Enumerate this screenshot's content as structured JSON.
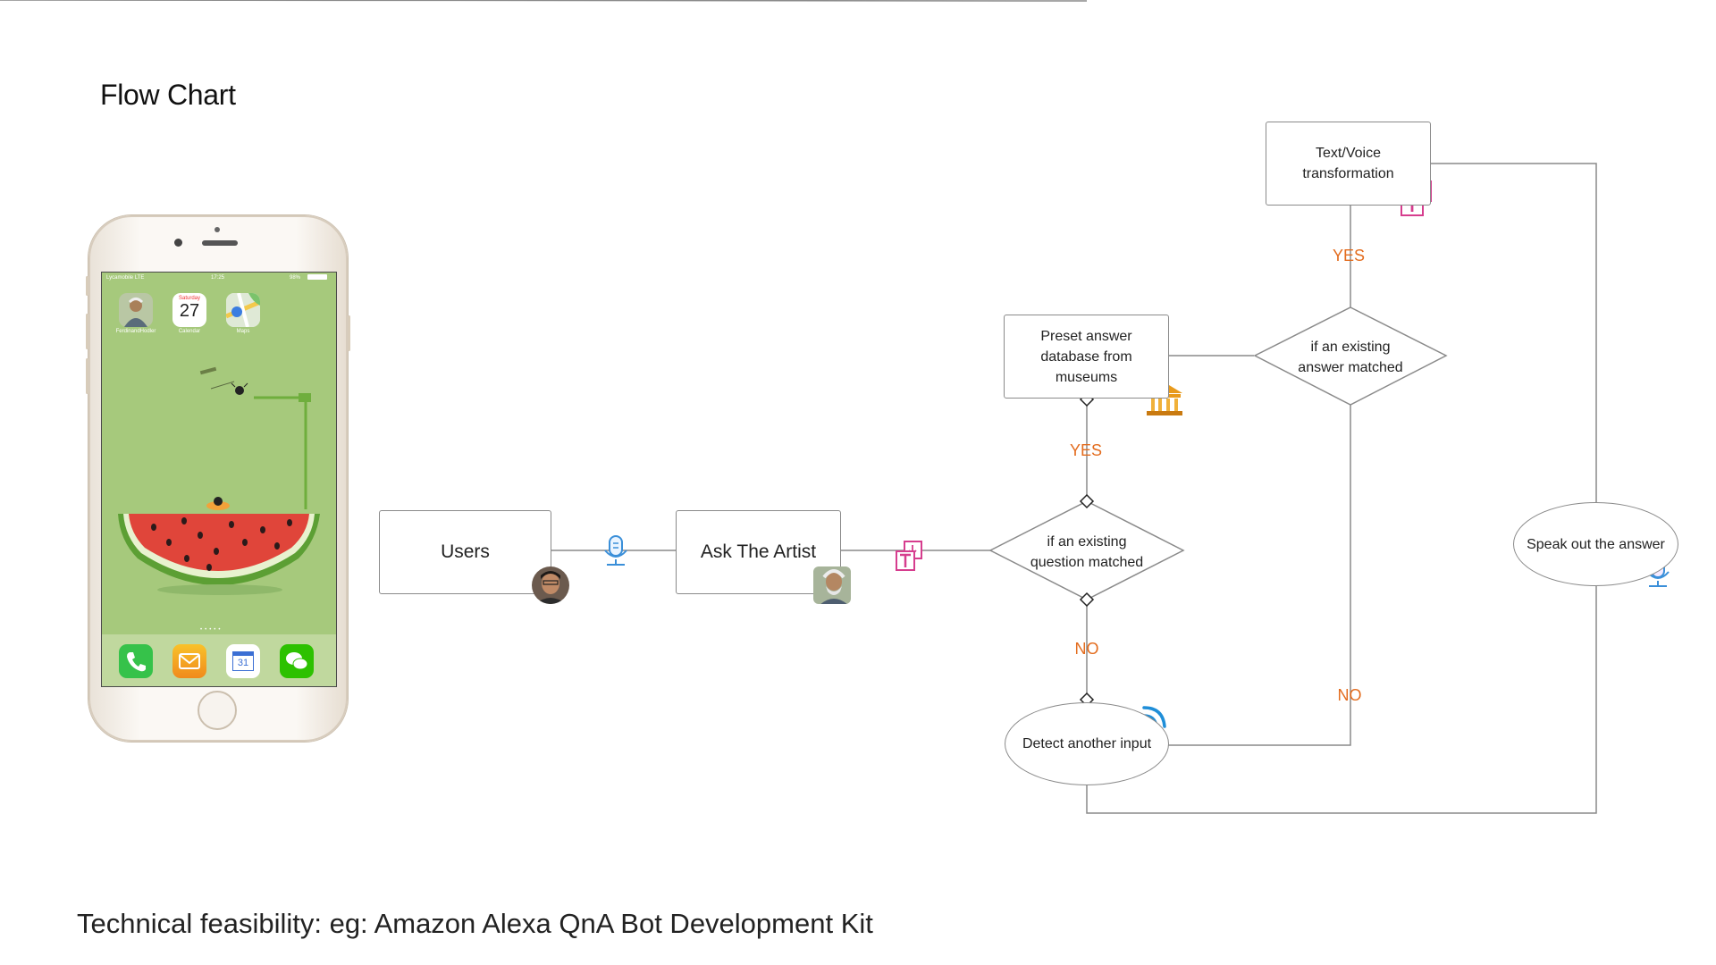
{
  "slide": {
    "title": "Flow Chart",
    "footer": "Technical feasibility: eg: Amazon Alexa QnA Bot Development Kit"
  },
  "phone": {
    "status": {
      "carrier": "Lycamobile  LTE",
      "time": "17:25",
      "battery": "98%"
    },
    "apps": [
      {
        "label": "FerdinandHodler",
        "icon": "portrait-icon"
      },
      {
        "label": "Calendar",
        "icon": "calendar-icon",
        "day_name": "Saturday",
        "day_number": "27"
      },
      {
        "label": "Maps",
        "icon": "maps-icon"
      }
    ],
    "dock": [
      {
        "icon": "phone-icon"
      },
      {
        "icon": "mail-icon"
      },
      {
        "icon": "google-calendar-icon",
        "text": "31"
      },
      {
        "icon": "wechat-icon"
      }
    ],
    "wallpaper": "watermelon-illustration",
    "colors": {
      "screen": "#a6c97c",
      "melon": "#e0453a",
      "rind": "#6fae3d"
    }
  },
  "flow": {
    "nodes": {
      "users": "Users",
      "ask_artist": "Ask The Artist",
      "question_match": [
        "if an existing",
        "question matched"
      ],
      "preset_db": [
        "Preset answer",
        "database from",
        "museums"
      ],
      "answer_match": [
        "if an existing",
        "answer matched"
      ],
      "text_voice": [
        "Text/Voice",
        "transformation"
      ],
      "speak_out": "Speak out the answer",
      "detect_input": "Detect another input"
    },
    "edge_labels": {
      "yes_db": "YES",
      "yes_transform": "YES",
      "no_detect": "NO",
      "no_answer": "NO"
    },
    "icons": [
      "microphone-icon",
      "translate-icon",
      "museum-icon",
      "wifi-signal-icon"
    ],
    "colors": {
      "line": "#8a8a8a",
      "label": "#e36c1e",
      "translate": "#d63d8e",
      "mic": "#3a8fd9"
    }
  }
}
